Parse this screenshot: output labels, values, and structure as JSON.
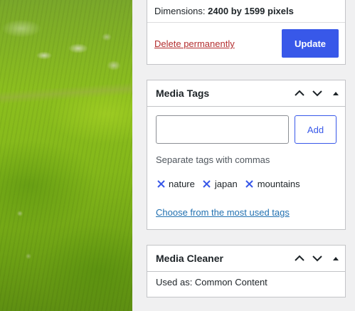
{
  "attachment": {
    "dimensions_label": "Dimensions:",
    "dimensions_value": "2400 by 1599 pixels",
    "delete_label": "Delete permanently",
    "update_label": "Update"
  },
  "media_tags": {
    "title": "Media Tags",
    "input_value": "",
    "add_label": "Add",
    "hint": "Separate tags with commas",
    "tags": [
      {
        "label": "nature"
      },
      {
        "label": "japan"
      },
      {
        "label": "mountains"
      }
    ],
    "choose_label": "Choose from the most used tags"
  },
  "media_cleaner": {
    "title": "Media Cleaner",
    "used_as": "Used as: Common Content"
  },
  "colors": {
    "accent": "#3858e9",
    "link": "#2271b1",
    "danger": "#b32d2e"
  },
  "icons": {
    "move_up": "chevron-up-icon",
    "move_down": "chevron-down-icon",
    "toggle": "caret-up-icon",
    "remove_tag": "x-icon"
  }
}
